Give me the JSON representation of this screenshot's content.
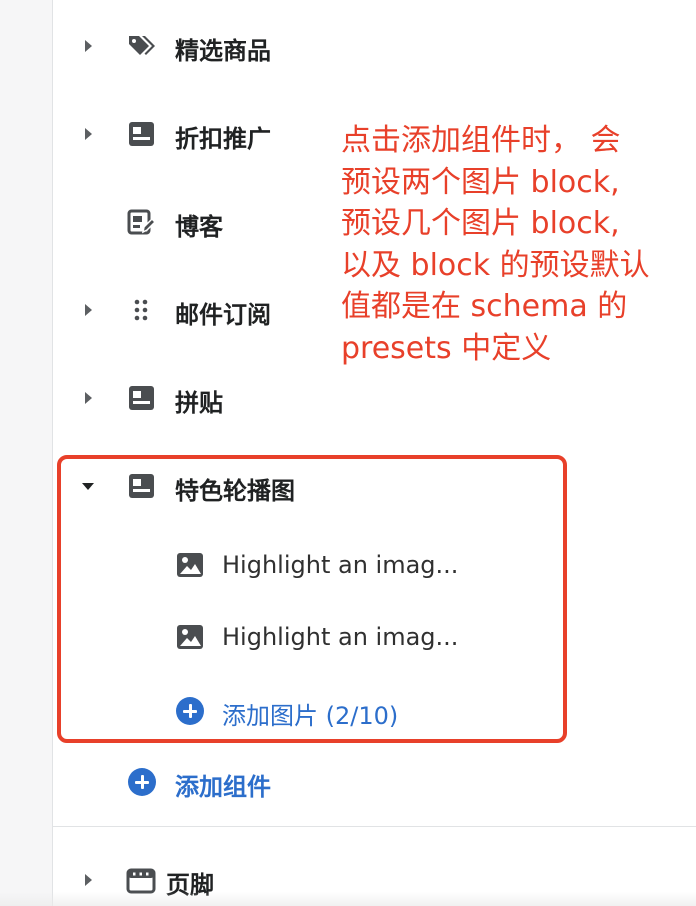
{
  "sections": [
    {
      "label": "精选商品",
      "icon": "tag-icon",
      "expandable": true
    },
    {
      "label": "折扣推广",
      "icon": "section-layout-icon",
      "expandable": true
    },
    {
      "label": "博客",
      "icon": "blog-edit-icon",
      "expandable": false
    },
    {
      "label": "邮件订阅",
      "icon": "drag-handle-icon",
      "expandable": true
    },
    {
      "label": "拼贴",
      "icon": "section-layout-icon",
      "expandable": true
    }
  ],
  "carousel": {
    "label": "特色轮播图",
    "icon": "section-layout-icon",
    "expanded": true,
    "blocks": [
      {
        "label": "Highlight an imag...",
        "icon": "image-icon"
      },
      {
        "label": "Highlight an imag...",
        "icon": "image-icon"
      }
    ],
    "add_block_label": "添加图片 (2/10)"
  },
  "add_section_label": "添加组件",
  "footer": {
    "label": "页脚",
    "icon": "footer-layout-icon"
  },
  "annotation": {
    "lines": [
      "点击添加组件时， 会",
      "预设两个图片 block,",
      "预设几个图片 block,",
      "以及 block 的预设默认",
      "值都是在 schema 的",
      "presets 中定义"
    ],
    "color": "#e8402a"
  },
  "colors": {
    "accent": "#2c6ecb",
    "highlight_border": "#e8402a",
    "text": "#202223"
  }
}
